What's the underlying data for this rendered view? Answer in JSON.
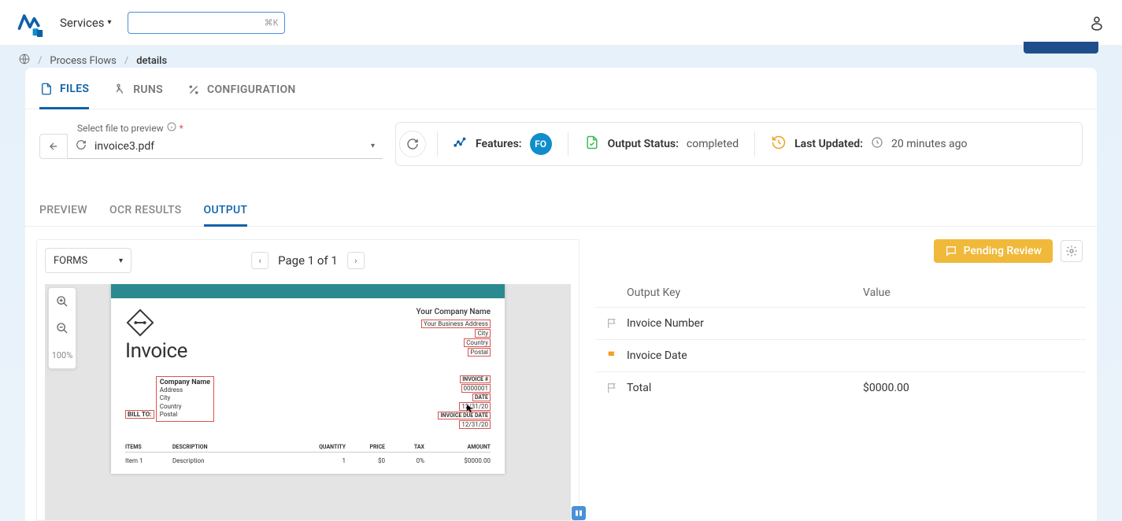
{
  "topnav": {
    "services": "Services",
    "search_placeholder": "",
    "search_kbd": "⌘K"
  },
  "breadcrumb": {
    "item1": "Process Flows",
    "item2": "details"
  },
  "main_tabs": {
    "files": "FILES",
    "runs": "RUNS",
    "config": "CONFIGURATION"
  },
  "file_select": {
    "label": "Select file to preview",
    "value": "invoice3.pdf"
  },
  "status": {
    "features_label": "Features:",
    "fo_badge": "FO",
    "output_label": "Output Status:",
    "output_value": "completed",
    "updated_label": "Last Updated:",
    "updated_value": "20 minutes ago"
  },
  "sub_tabs": {
    "preview": "PREVIEW",
    "ocr": "OCR RESULTS",
    "output": "OUTPUT"
  },
  "forms_dd": "FORMS",
  "pager": "Page 1 of 1",
  "zoom": "100%",
  "pending_review": "Pending Review",
  "output_table": {
    "col_key": "Output Key",
    "col_val": "Value",
    "rows": [
      {
        "key": "Invoice Number",
        "value": "",
        "flag": "gray"
      },
      {
        "key": "Invoice Date",
        "value": "",
        "flag": "amber"
      },
      {
        "key": "Total",
        "value": "$0000.00",
        "flag": "gray"
      }
    ]
  },
  "doc": {
    "company": "Your Company Name",
    "addr1": "Your Business Address",
    "addr2": "City",
    "addr3": "Country",
    "addr4": "Postal",
    "title": "Invoice",
    "billto": "BILL TO:",
    "billcompany": "Company Name",
    "billlines": [
      "Address",
      "City",
      "Country",
      "Postal"
    ],
    "meta_invnum_lbl": "INVOICE #",
    "meta_invnum": "0000001",
    "meta_date_lbl": "DATE",
    "meta_date": "12/31/20",
    "meta_due_lbl": "INVOICE DUE DATE",
    "meta_due": "12/31/20",
    "hdr": {
      "items": "ITEMS",
      "desc": "DESCRIPTION",
      "qty": "QUANTITY",
      "price": "PRICE",
      "tax": "TAX",
      "amt": "AMOUNT"
    },
    "row": {
      "items": "Item 1",
      "desc": "Description",
      "qty": "1",
      "price": "$0",
      "tax": "0%",
      "amt": "$0000.00"
    }
  }
}
